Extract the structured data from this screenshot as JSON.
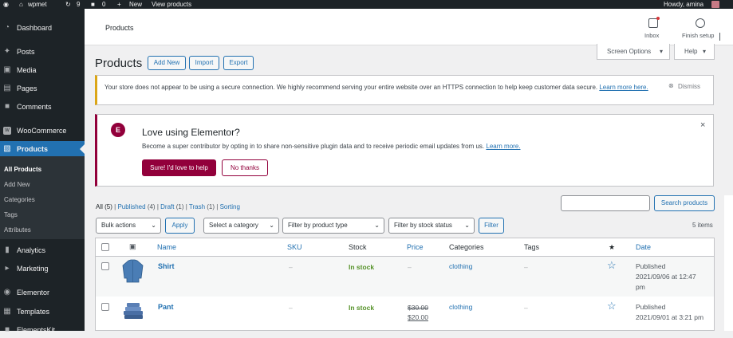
{
  "admin_bar": {
    "site": "wpmet",
    "updates": "9",
    "comments": "0",
    "new": "New",
    "view": "View products",
    "howdy": "Howdy, amina"
  },
  "sidebar": {
    "dashboard": "Dashboard",
    "posts": "Posts",
    "media": "Media",
    "pages": "Pages",
    "comments": "Comments",
    "woocommerce": "WooCommerce",
    "products": "Products",
    "sub": {
      "all": "All Products",
      "add": "Add New",
      "categories": "Categories",
      "tags": "Tags",
      "attributes": "Attributes"
    },
    "analytics": "Analytics",
    "marketing": "Marketing",
    "elementor": "Elementor",
    "templates": "Templates",
    "elementskit": "ElementsKit"
  },
  "topbar": {
    "title": "Products",
    "inbox": "Inbox",
    "finish": "Finish setup"
  },
  "page": {
    "title": "Products",
    "add_new": "Add New",
    "import": "Import",
    "export": "Export",
    "screen_options": "Screen Options",
    "help": "Help"
  },
  "notice_https": {
    "text": "Your store does not appear to be using a secure connection. We highly recommend serving your entire website over an HTTPS connection to help keep customer data secure.",
    "learn": "Learn more here.",
    "dismiss": "Dismiss"
  },
  "notice_elementor": {
    "title": "Love using Elementor?",
    "text": "Become a super contributor by opting in to share non-sensitive plugin data and to receive periodic email updates from us.",
    "learn": "Learn more.",
    "accept": "Sure! I'd love to help",
    "decline": "No thanks"
  },
  "filters": {
    "all": "All",
    "all_count": "(5)",
    "published": "Published",
    "published_count": "(4)",
    "draft": "Draft",
    "draft_count": "(1)",
    "trash": "Trash",
    "trash_count": "(1)",
    "sorting": "Sorting",
    "search_button": "Search products",
    "bulk": "Bulk actions",
    "apply": "Apply",
    "category": "Select a category",
    "type": "Filter by product type",
    "stock": "Filter by stock status",
    "filter": "Filter",
    "items": "5 items"
  },
  "table": {
    "headers": {
      "name": "Name",
      "sku": "SKU",
      "stock": "Stock",
      "price": "Price",
      "categories": "Categories",
      "tags": "Tags",
      "date": "Date"
    },
    "rows": [
      {
        "name": "Shirt",
        "sku": "–",
        "stock": "In stock",
        "price": "–",
        "category": "clothing",
        "tags": "–",
        "date1": "Published",
        "date2": "2021/09/06 at 12:47",
        "date3": "pm"
      },
      {
        "name": "Pant",
        "sku": "–",
        "stock": "In stock",
        "price_old": "$30.00",
        "price": "$20.00",
        "category": "clothing",
        "tags": "–",
        "date1": "Published",
        "date2": "2021/09/01 at 3:21 pm"
      }
    ]
  },
  "colors": {
    "accent": "#2271b1",
    "sidebar": "#1d2327",
    "stock": "#7ad03a",
    "elementor": "#92003b"
  }
}
